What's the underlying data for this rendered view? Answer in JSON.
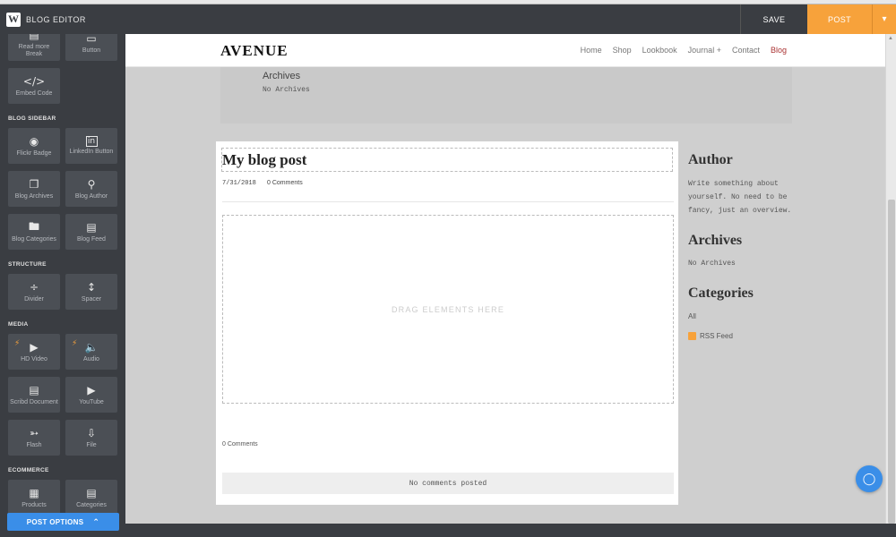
{
  "app": {
    "title": "BLOG EDITOR",
    "logo_letter": "W",
    "save_label": "SAVE",
    "post_label": "POST"
  },
  "sidebar": {
    "top_tiles": [
      {
        "label": "Read more Break",
        "icon": "read-more-icon"
      },
      {
        "label": "Button",
        "icon": "button-icon"
      },
      {
        "label": "Embed Code",
        "icon": "code-icon"
      }
    ],
    "sections": {
      "blog_sidebar": "BLOG SIDEBAR",
      "structure": "STRUCTURE",
      "media": "MEDIA",
      "ecommerce": "ECOMMERCE"
    },
    "blog_sidebar_tiles": [
      {
        "label": "Flickr Badge",
        "icon": "flickr-icon"
      },
      {
        "label": "LinkedIn Button",
        "icon": "linkedin-icon"
      },
      {
        "label": "Blog Archives",
        "icon": "archives-icon"
      },
      {
        "label": "Blog Author",
        "icon": "author-icon"
      },
      {
        "label": "Blog Categories",
        "icon": "folder-icon"
      },
      {
        "label": "Blog Feed",
        "icon": "feed-icon"
      }
    ],
    "structure_tiles": [
      {
        "label": "Divider",
        "icon": "divider-icon"
      },
      {
        "label": "Spacer",
        "icon": "spacer-icon"
      }
    ],
    "media_tiles": [
      {
        "label": "HD Video",
        "icon": "video-icon"
      },
      {
        "label": "Audio",
        "icon": "audio-icon"
      },
      {
        "label": "Scribd Document",
        "icon": "document-icon"
      },
      {
        "label": "YouTube",
        "icon": "youtube-icon"
      },
      {
        "label": "Flash",
        "icon": "flash-icon"
      },
      {
        "label": "File",
        "icon": "file-icon"
      }
    ],
    "ecommerce_tiles": [
      {
        "label": "Products",
        "icon": "products-icon"
      },
      {
        "label": "Categories",
        "icon": "categories-icon"
      }
    ],
    "post_options_label": "POST OPTIONS"
  },
  "site": {
    "logo": "AVENUE",
    "nav": [
      "Home",
      "Shop",
      "Lookbook",
      "Journal +",
      "Contact",
      "Blog"
    ],
    "active_nav": "Blog"
  },
  "prev_section": {
    "title": "Archives",
    "text": "No Archives"
  },
  "post": {
    "title": "My blog post",
    "date": "7/31/2018",
    "comments_link": "0 Comments",
    "drop_placeholder": "DRAG ELEMENTS HERE",
    "comments_count": "0 Comments",
    "no_comments": "No comments posted"
  },
  "right_sidebar": {
    "author_title": "Author",
    "author_text": "Write something about yourself. No need to be fancy, just an overview.",
    "archives_title": "Archives",
    "archives_text": "No Archives",
    "categories_title": "Categories",
    "categories_all": "All",
    "rss_label": "RSS Feed"
  },
  "colors": {
    "accent_orange": "#f7a23b",
    "accent_blue": "#3a8ee8",
    "dark_bar": "#3a3d42"
  }
}
